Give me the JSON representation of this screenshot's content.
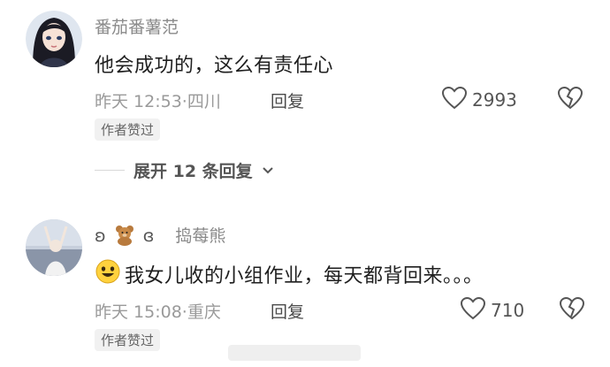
{
  "comments": [
    {
      "username": "番茄番薯范",
      "text": "他会成功的，这么有责任心",
      "time": "昨天 12:53",
      "location": "四川",
      "reply_label": "回复",
      "likes": "2993",
      "badge": "作者赞过"
    },
    {
      "username_prefix": "ʚ",
      "username_suffix": "ɞ",
      "username": "捣莓熊",
      "text": "我女儿收的小组作业，每天都背回来。。。",
      "time": "昨天 15:08",
      "location": "重庆",
      "reply_label": "回复",
      "likes": "710",
      "badge": "作者赞过"
    }
  ],
  "expand_replies": {
    "label": "展开 12 条回复"
  },
  "separator": "·",
  "icons": {
    "like": "heart-outline-icon",
    "dislike": "broken-heart-icon",
    "expand": "chevron-down-icon",
    "emoji": "smile-emoji-icon",
    "bear": "teddy-bear-emoji-icon"
  }
}
